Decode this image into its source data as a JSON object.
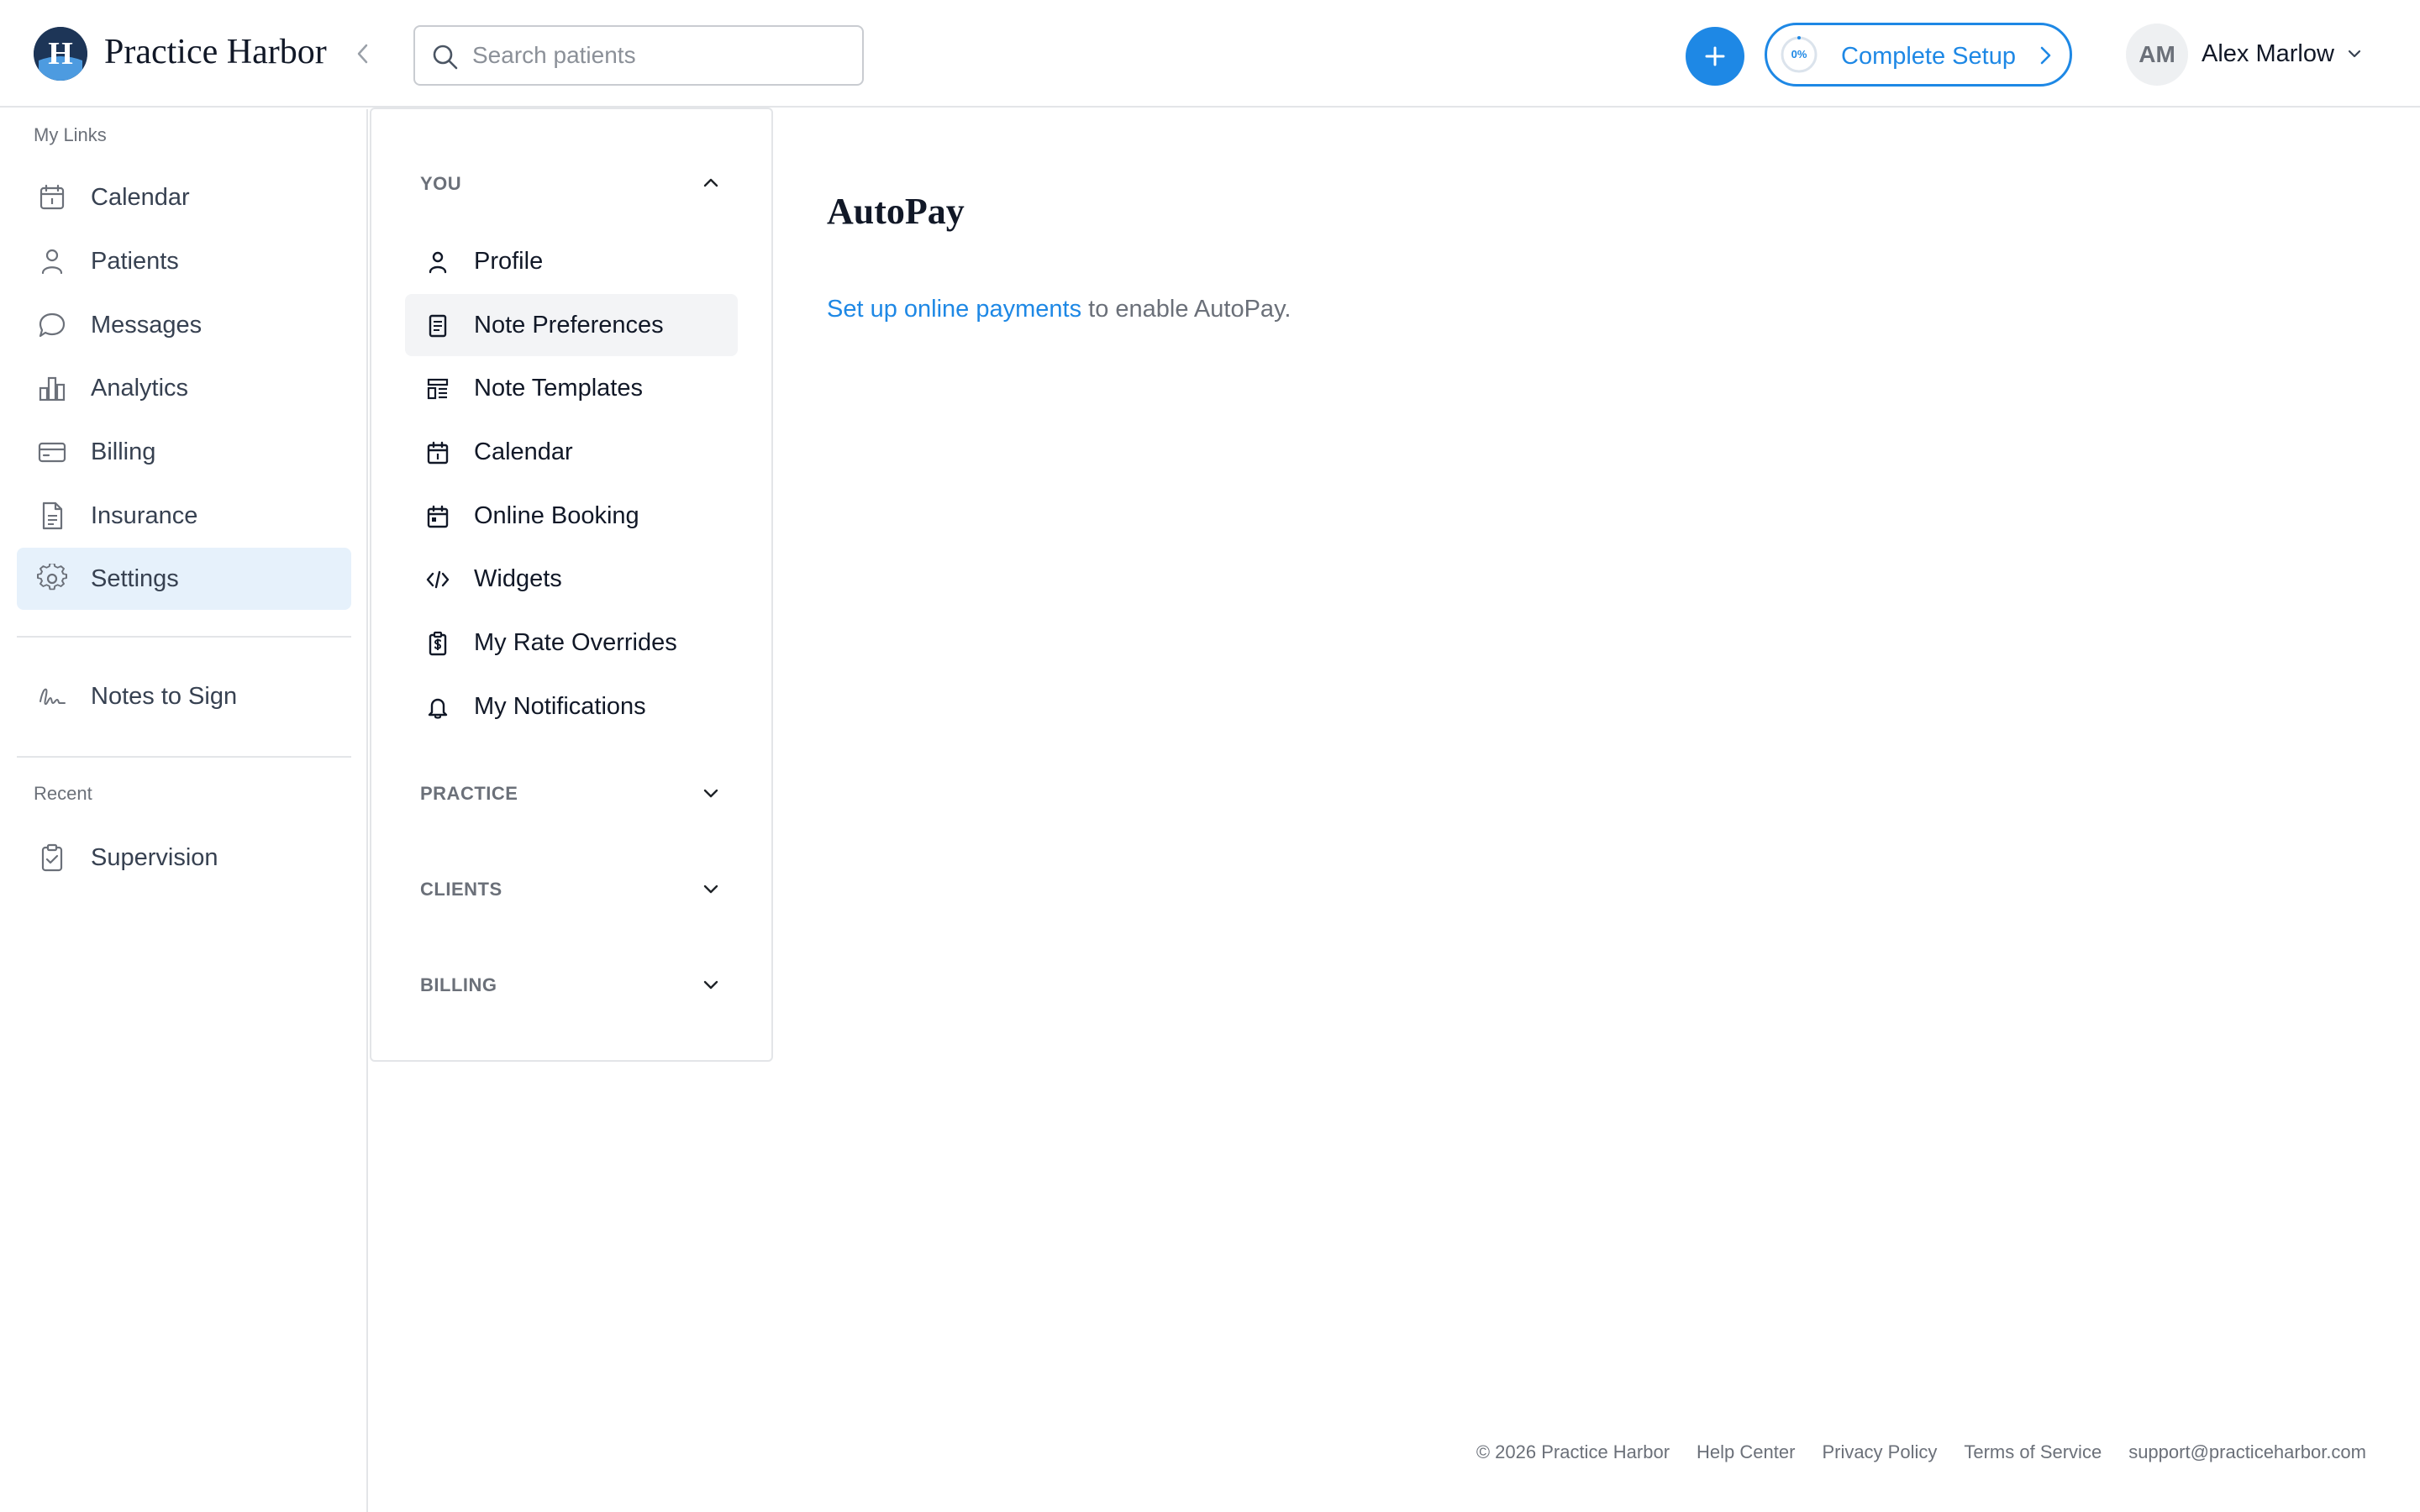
{
  "app": {
    "name": "Practice Harbor",
    "logo_letter": "H"
  },
  "header": {
    "search_placeholder": "Search patients",
    "add_button_icon": "plus-icon",
    "setup": {
      "progress_text": "0%",
      "progress_percent": 0,
      "label": "Complete Setup"
    },
    "user": {
      "initials": "AM",
      "name": "Alex Marlow"
    }
  },
  "sidebar": {
    "my_links_label": "My Links",
    "items": [
      {
        "label": "Calendar",
        "icon": "calendar-icon"
      },
      {
        "label": "Patients",
        "icon": "person-icon"
      },
      {
        "label": "Messages",
        "icon": "chat-bubble-icon"
      },
      {
        "label": "Analytics",
        "icon": "bar-chart-icon"
      },
      {
        "label": "Billing",
        "icon": "credit-card-icon"
      },
      {
        "label": "Insurance",
        "icon": "document-icon"
      },
      {
        "label": "Settings",
        "icon": "gear-icon",
        "active": true
      }
    ],
    "notes_to_sign": {
      "label": "Notes to Sign",
      "icon": "signature-icon"
    },
    "recent_label": "Recent",
    "recent_items": [
      {
        "label": "Supervision",
        "icon": "clipboard-check-icon"
      }
    ]
  },
  "settings_nav": {
    "groups": [
      {
        "title": "YOU",
        "expanded": true,
        "items": [
          {
            "label": "Profile",
            "icon": "person-icon"
          },
          {
            "label": "Note Preferences",
            "icon": "note-icon",
            "active": true
          },
          {
            "label": "Note Templates",
            "icon": "template-icon"
          },
          {
            "label": "Calendar",
            "icon": "calendar-icon"
          },
          {
            "label": "Online Booking",
            "icon": "calendar-booking-icon"
          },
          {
            "label": "Widgets",
            "icon": "code-icon"
          },
          {
            "label": "My Rate Overrides",
            "icon": "dollar-clipboard-icon"
          },
          {
            "label": "My Notifications",
            "icon": "bell-icon"
          }
        ]
      },
      {
        "title": "PRACTICE",
        "expanded": false
      },
      {
        "title": "CLIENTS",
        "expanded": false
      },
      {
        "title": "BILLING",
        "expanded": false
      }
    ]
  },
  "main": {
    "title": "AutoPay",
    "link_text": "Set up online payments",
    "rest_text": " to enable AutoPay."
  },
  "footer": {
    "copyright": "© 2026 Practice Harbor",
    "help": "Help Center",
    "privacy": "Privacy Policy",
    "terms": "Terms of Service",
    "email": "support@practiceharbor.com"
  },
  "colors": {
    "accent": "#1e88e5",
    "brand_dark": "#1d3557",
    "active_nav_bg": "#e6f1fb",
    "active_settings_bg": "#f3f4f6",
    "muted_text": "#6b7079"
  }
}
